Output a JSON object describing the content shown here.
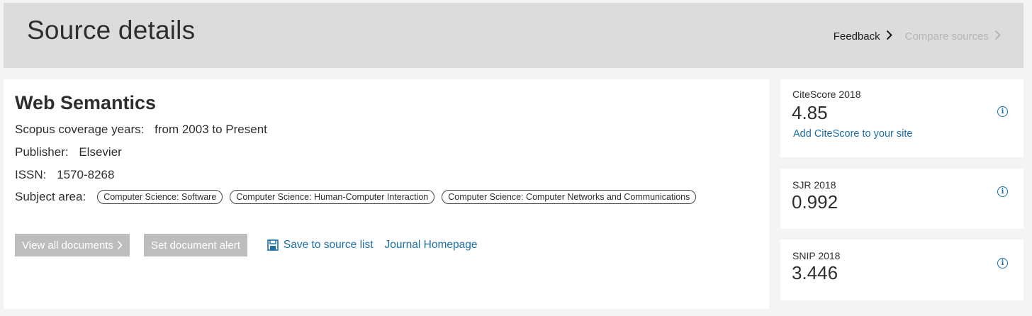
{
  "header": {
    "title": "Source details",
    "feedback_label": "Feedback",
    "compare_label": "Compare sources"
  },
  "source": {
    "title": "Web Semantics",
    "coverage_label": "Scopus coverage years:",
    "coverage_value": "from 2003 to Present",
    "publisher_label": "Publisher:",
    "publisher_value": "Elsevier",
    "issn_label": "ISSN:",
    "issn_value": "1570-8268",
    "subject_label": "Subject area:",
    "subjects": [
      "Computer Science: Software",
      "Computer Science: Human-Computer Interaction",
      "Computer Science: Computer Networks and Communications"
    ]
  },
  "actions": {
    "view_all_label": "View all documents",
    "alert_label": "Set document alert",
    "save_label": "Save to source list",
    "homepage_label": "Journal Homepage"
  },
  "metrics": {
    "citescore_label": "CiteScore 2018",
    "citescore_value": "4.85",
    "citescore_link": "Add CiteScore to your site",
    "sjr_label": "SJR 2018",
    "sjr_value": "0.992",
    "snip_label": "SNIP 2018",
    "snip_value": "3.446"
  },
  "icons": {
    "info": "info-icon",
    "chevron": "chevron-right-icon",
    "save": "save-icon"
  },
  "colors": {
    "link": "#1b6ea8",
    "header_bg": "#dcdcdc",
    "disabled_button": "#bdbdbd"
  }
}
